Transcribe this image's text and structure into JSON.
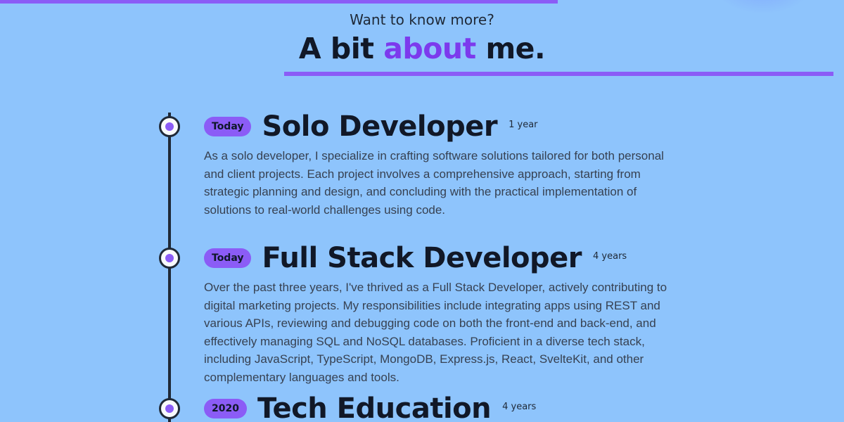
{
  "header": {
    "subtitle": "Want to know more?",
    "title_part1": "A bit ",
    "title_accent": "about",
    "title_part2": " me."
  },
  "timeline": [
    {
      "badge": "Today",
      "role": "Solo Developer",
      "duration": "1 year",
      "description": "As a solo developer, I specialize in crafting software solutions tailored for both personal and client projects. Each project involves a comprehensive approach, starting from strategic planning and design, and concluding with the practical implementation of solutions to real-world challenges using code."
    },
    {
      "badge": "Today",
      "role": "Full Stack Developer",
      "duration": "4 years",
      "description": "Over the past three years, I've thrived as a Full Stack Developer, actively contributing to digital marketing projects. My responsibilities include integrating apps using REST and various APIs, reviewing and debugging code on both the front-end and back-end, and effectively managing SQL and NoSQL databases. Proficient in a diverse tech stack, including JavaScript, TypeScript, MongoDB, Express.js, React, SvelteKit, and other complementary languages and tools."
    },
    {
      "badge": "2020",
      "role": "Tech Education",
      "duration": "4 years",
      "description": ""
    }
  ],
  "colors": {
    "background": "#8ec4fc",
    "accent": "#8b5cf6",
    "accent_text": "#7c3aed",
    "text_dark": "#111827"
  }
}
